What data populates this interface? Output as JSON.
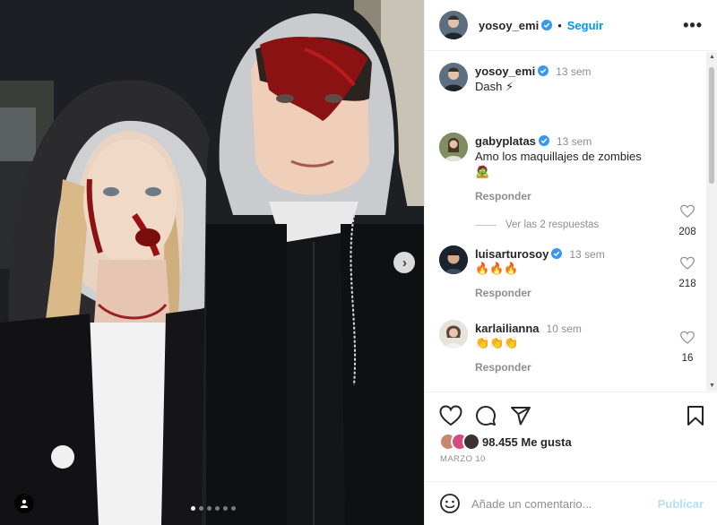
{
  "post": {
    "photo_alt": "",
    "carousel_count": 6,
    "carousel_active": 0,
    "next_arrow": "chevron-right-icon"
  },
  "header": {
    "username": "yosoy_emi",
    "verified": true,
    "separator": "•",
    "follow_label": "Seguir",
    "more_label": "•••"
  },
  "caption": {
    "username": "yosoy_emi",
    "time": "13 sem",
    "text": "Dash ⚡"
  },
  "comments": [
    {
      "username": "gabyplatas",
      "verified": true,
      "time": "13 sem",
      "text": "Amo los maquillajes de zombies",
      "text2": "🧟",
      "reply_label": "Responder",
      "likes": "208",
      "avatar_color": "#6b7b52"
    },
    {
      "username": "luisarturosoy",
      "verified": true,
      "time": "13 sem",
      "text": "🔥🔥🔥",
      "reply_label": "Responder",
      "likes": "218",
      "avatar_color": "#2b3340"
    },
    {
      "username": "karlailianna",
      "verified": false,
      "time": "10 sem",
      "text": "👏👏👏",
      "reply_label": "Responder",
      "likes": "16",
      "avatar_color": "#d9d4ce"
    }
  ],
  "view_replies_label": "Ver las 2 respuestas",
  "actions": {
    "icons": [
      "heart-icon",
      "comment-icon",
      "share-icon",
      "bookmark-icon"
    ]
  },
  "likes": {
    "count": "98.455",
    "suffix": " Me gusta"
  },
  "date": "MARZO 10",
  "add_comment": {
    "placeholder": "Añade un comentario...",
    "publish_label": "Publicar"
  },
  "colors": {
    "accent": "#0095f6",
    "verified": "#3897f0",
    "publish_disabled": "#b2dffc"
  }
}
